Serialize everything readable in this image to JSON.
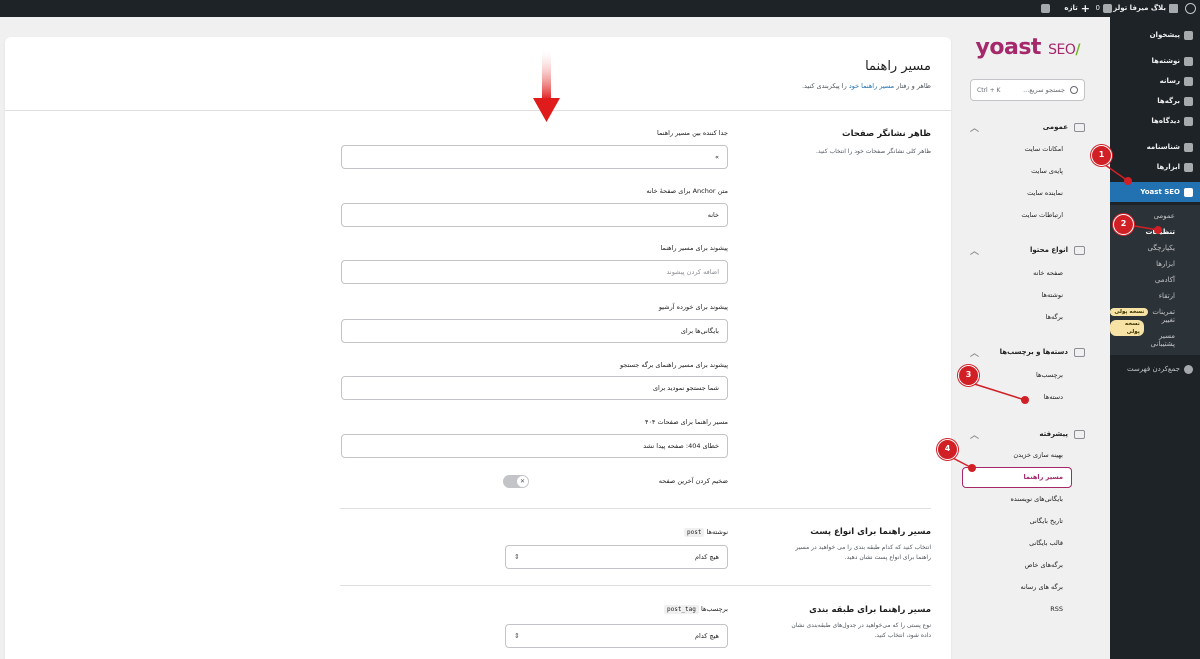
{
  "adminbar": {
    "site_name": "بلاگ میرفا تولز",
    "comments_count": "0",
    "new_label": "تازه"
  },
  "adminmenu": {
    "items": [
      {
        "label": "پیشخوان",
        "icon": "dashboard-icon"
      },
      {
        "label": "نوشته‌ها",
        "icon": "pin-icon"
      },
      {
        "label": "رسانه",
        "icon": "media-icon"
      },
      {
        "label": "برگه‌ها",
        "icon": "pages-icon"
      },
      {
        "label": "دیدگاه‌ها",
        "icon": "comments-icon"
      },
      {
        "label": "شناسنامه",
        "icon": "user-icon"
      },
      {
        "label": "ابزارها",
        "icon": "tools-icon"
      },
      {
        "label": "Yoast SEO",
        "icon": "yoast-icon"
      }
    ],
    "submenu": [
      {
        "label": "عمومی"
      },
      {
        "label": "تنظیمات"
      },
      {
        "label": "یکپارچگی"
      },
      {
        "label": "ابزارها"
      },
      {
        "label": "آکادمی"
      },
      {
        "label": "ارتقاء"
      },
      {
        "label": "تمرینات",
        "badge": "نسخه پولی"
      },
      {
        "label": "تغییر مسیر",
        "badge": "نسخه پولی"
      },
      {
        "label": "پشتیبانی"
      }
    ],
    "collapse_label": "جمع‌کردن فهرست"
  },
  "yoast_nav": {
    "logo_text": "yoast",
    "logo_seo": "SEO",
    "logo_slash": "/",
    "search_placeholder": "جستجو سریع...",
    "search_shortcut": "Ctrl + K",
    "sections": [
      {
        "title": "عمومی",
        "links": [
          "امکانات سایت",
          "پایه‌ی سایت",
          "نماینده سایت",
          "ارتباطات سایت"
        ]
      },
      {
        "title": "انواع محتوا",
        "links": [
          "صفحه خانه",
          "نوشته‌ها",
          "برگه‌ها"
        ]
      },
      {
        "title": "دسته‌ها و برچسب‌ها",
        "links": [
          "برچسب‌ها",
          "دسته‌ها"
        ]
      },
      {
        "title": "پیشرفته",
        "links": [
          "بهینه سازی خزیدن",
          "مسیر راهنما",
          "بایگانی‌های نویسنده",
          "تاریخ بایگانی",
          "قالب بایگانی",
          "برگه‌های خاص",
          "برگه های رسانه",
          "RSS"
        ]
      }
    ]
  },
  "main": {
    "title": "مسیر راهنما",
    "desc_prefix": "ظاهر و رفتار",
    "desc_link": "مسیر راهنما خود",
    "desc_suffix": "را پیکربندی کنید.",
    "group1": {
      "title": "ظاهر نشانگر صفحات",
      "desc": "ظاهر کلی نشانگر صفحات خود را انتخاب کنید."
    },
    "fields": [
      {
        "label": "جدا کننده بین مسیر راهنما",
        "value": "»"
      },
      {
        "label": "متن Anchor برای صفحهٔ خانه",
        "value": "خانه"
      },
      {
        "label": "پیشوند برای مسیر راهنما",
        "value": "اضافه کردن پیشوند"
      },
      {
        "label": "پیشوند برای خورده آرشیو",
        "value": "بایگانی‌ها برای"
      },
      {
        "label": "پیشوند برای مسیر راهنمای برگه جستجو",
        "value": "شما جستجو نمودید برای"
      },
      {
        "label": "مسیر راهنما برای صفحات ۴۰۴",
        "value": "خطای 404: صفحه پیدا نشد"
      }
    ],
    "toggle_label": "ضخیم کردن آخرین صفحه",
    "toggle_state": "off",
    "group2": {
      "title": "مسیر راهنما برای انواع پست",
      "desc": "انتخاب کنید که کدام طبقه بندی را می خواهید در مسیر راهنما برای انواع پست نشان دهید.",
      "field_label": "نوشته‌ها",
      "field_code": "post",
      "field_value": "هیچ کدام"
    },
    "group3": {
      "title": "مسیر راهنما برای طبقه بندی",
      "desc": "نوع پستی را که می‌خواهید در جدول‌های طبقه‌بندی نشان داده شود، انتخاب کنید.",
      "field_label": "برچسب‌ها",
      "field_code": "post_tag",
      "field_value": "هیچ کدام"
    }
  },
  "annotations": [
    "1",
    "2",
    "3",
    "4"
  ],
  "colors": {
    "yoast": "#a4286a",
    "wp_blue": "#2271b1",
    "annotation": "#d11f26"
  }
}
